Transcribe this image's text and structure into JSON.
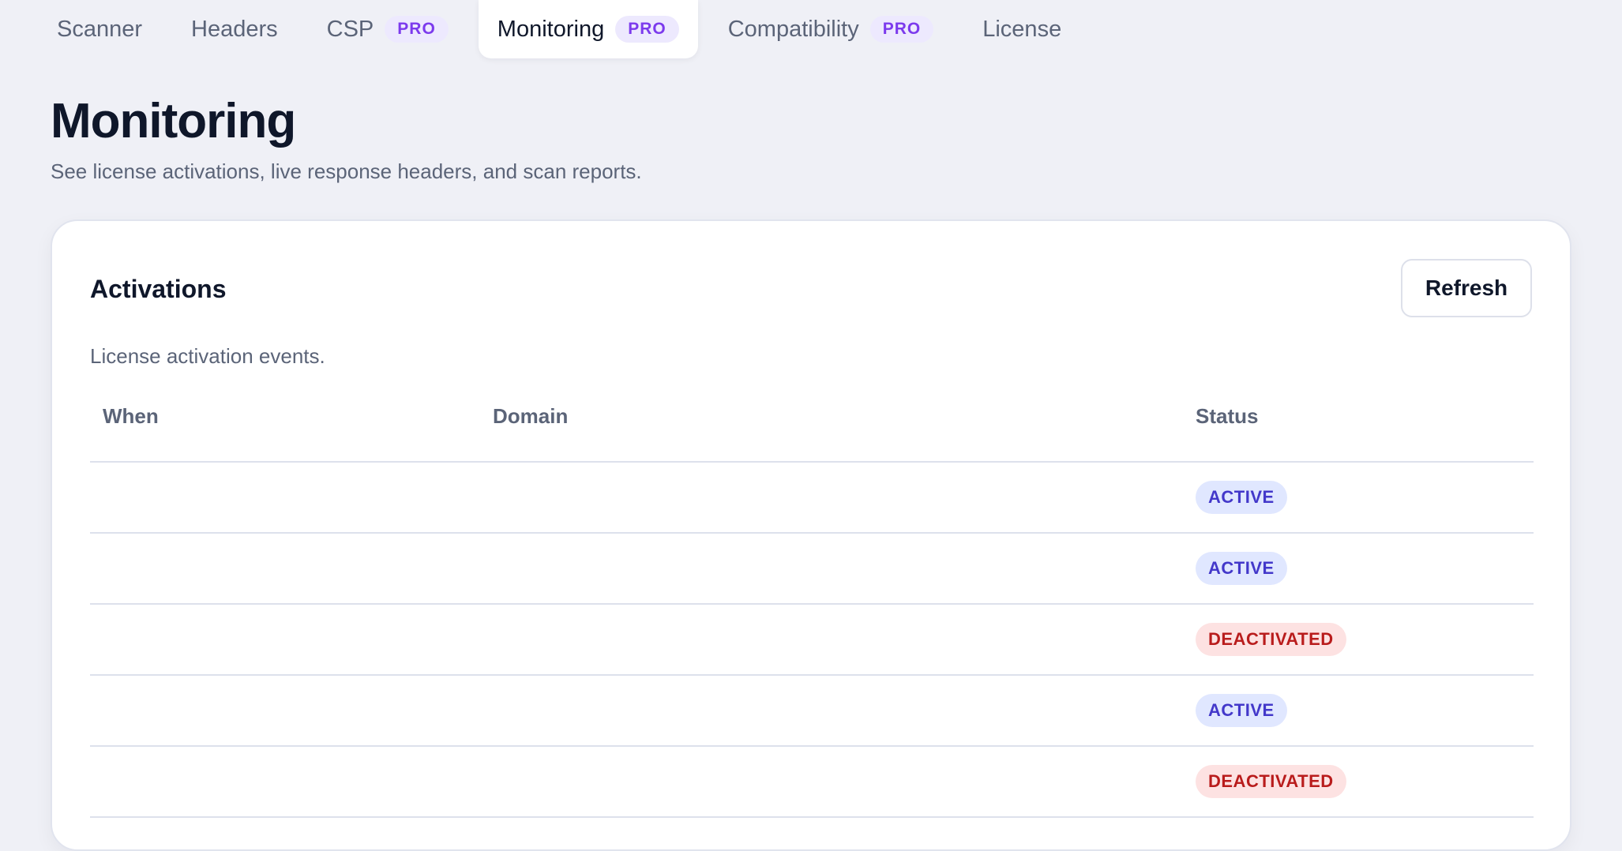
{
  "nav": {
    "tabs": [
      {
        "label": "Scanner",
        "pro": ""
      },
      {
        "label": "Headers",
        "pro": ""
      },
      {
        "label": "CSP",
        "pro": "PRO"
      },
      {
        "label": "Monitoring",
        "pro": "PRO"
      },
      {
        "label": "Compatibility",
        "pro": "PRO"
      },
      {
        "label": "License",
        "pro": ""
      }
    ],
    "active": "Monitoring"
  },
  "page": {
    "title": "Monitoring",
    "subtitle": "See license activations, live response headers, and scan reports."
  },
  "activations": {
    "title": "Activations",
    "refresh_label": "Refresh",
    "description": "License activation events.",
    "columns": {
      "when": "When",
      "domain": "Domain",
      "status": "Status"
    },
    "rows": [
      {
        "when": "",
        "domain": "",
        "status": "ACTIVE"
      },
      {
        "when": "",
        "domain": "",
        "status": "ACTIVE"
      },
      {
        "when": "",
        "domain": "",
        "status": "DEACTIVATED"
      },
      {
        "when": "",
        "domain": "",
        "status": "ACTIVE"
      },
      {
        "when": "",
        "domain": "",
        "status": "DEACTIVATED"
      }
    ]
  },
  "colors": {
    "background": "#eff0f6",
    "pro_badge_bg": "#ede9fe",
    "pro_badge_text": "#7c3aed",
    "active_bg": "#e0e7ff",
    "active_text": "#4338ca",
    "deactivated_bg": "#fde2e2",
    "deactivated_text": "#b91c1c"
  }
}
